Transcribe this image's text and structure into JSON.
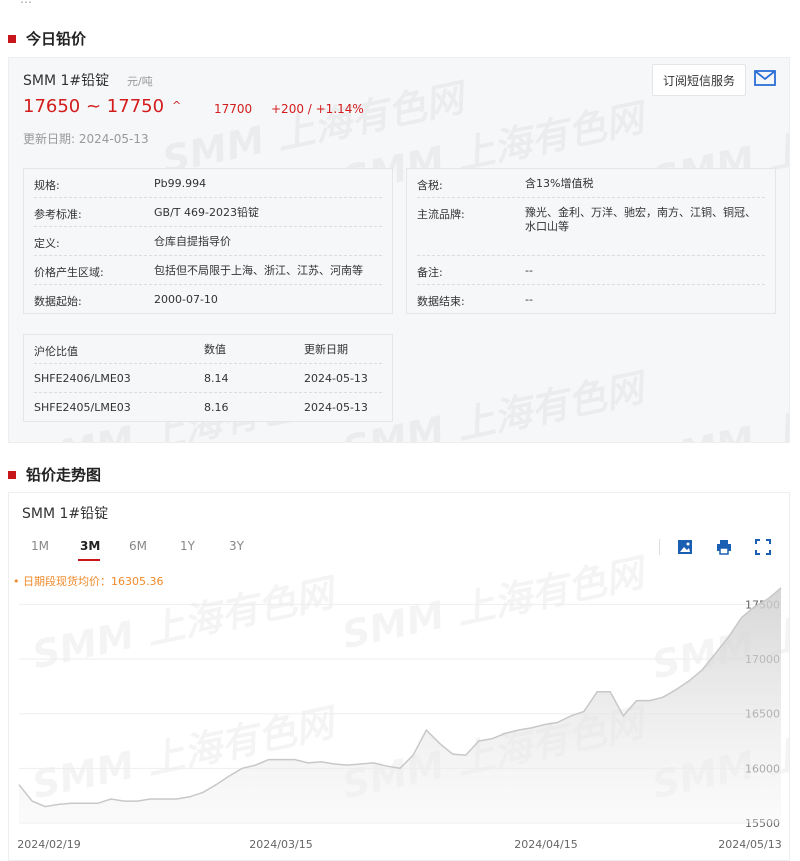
{
  "section1": {
    "title": "今日铅价"
  },
  "product": {
    "name": "SMM 1#铅锭",
    "unit": "元/吨",
    "price_range": "17650 ~ 17750",
    "avg": "17700",
    "change": "+200 / +1.14%",
    "update_label": "更新日期:",
    "update_date": "2024-05-13",
    "subscribe_label": "订阅短信服务"
  },
  "info_left": [
    {
      "k": "规格:",
      "v": "Pb99.994"
    },
    {
      "k": "参考标准:",
      "v": "GB/T 469-2023铅锭"
    },
    {
      "k": "定义:",
      "v": "仓库自提指导价"
    },
    {
      "k": "价格产生区域:",
      "v": "包括但不局限于上海、浙江、江苏、河南等"
    },
    {
      "k": "数据起始:",
      "v": "2000-07-10"
    }
  ],
  "info_right": [
    {
      "k": "含税:",
      "v": "含13%增值税"
    },
    {
      "k": "主流品牌:",
      "v": "豫光、金利、万洋、驰宏，南方、江铜、铜冠、水口山等"
    },
    {
      "k": "备注:",
      "v": "--"
    },
    {
      "k": "数据结束:",
      "v": "--"
    }
  ],
  "ratio_table": {
    "headers": [
      "沪伦比值",
      "数值",
      "更新日期"
    ],
    "rows": [
      [
        "SHFE2406/LME03",
        "8.14",
        "2024-05-13"
      ],
      [
        "SHFE2405/LME03",
        "8.16",
        "2024-05-13"
      ]
    ]
  },
  "watermark": "SMM 上海有色网",
  "section2": {
    "title": "铅价走势图"
  },
  "chart_panel": {
    "name": "SMM 1#铅锭",
    "tabs": [
      "1M",
      "3M",
      "6M",
      "1Y",
      "3Y"
    ],
    "active_tab": "3M",
    "avg_label": "• 日期段现货均价：16305.36",
    "icons": [
      "download-image-icon",
      "print-icon",
      "fullscreen-icon"
    ]
  },
  "chart_data": {
    "type": "area",
    "x_ticks": [
      "2024/02/19",
      "2024/03/15",
      "2024/04/15",
      "2024/05/13"
    ],
    "y_ticks": [
      15500,
      16000,
      16500,
      17000,
      17500
    ],
    "ylim": [
      15500,
      17650
    ],
    "values": [
      15850,
      15700,
      15650,
      15670,
      15680,
      15680,
      15680,
      15720,
      15700,
      15700,
      15720,
      15720,
      15720,
      15740,
      15780,
      15850,
      15930,
      16000,
      16030,
      16080,
      16080,
      16080,
      16050,
      16060,
      16040,
      16030,
      16040,
      16050,
      16020,
      16000,
      16120,
      16350,
      16230,
      16130,
      16120,
      16250,
      16270,
      16320,
      16350,
      16370,
      16400,
      16420,
      16480,
      16520,
      16700,
      16700,
      16480,
      16620,
      16620,
      16650,
      16720,
      16800,
      16900,
      17050,
      17200,
      17380,
      17480,
      17550,
      17650
    ],
    "color": "#c8c8c8"
  }
}
